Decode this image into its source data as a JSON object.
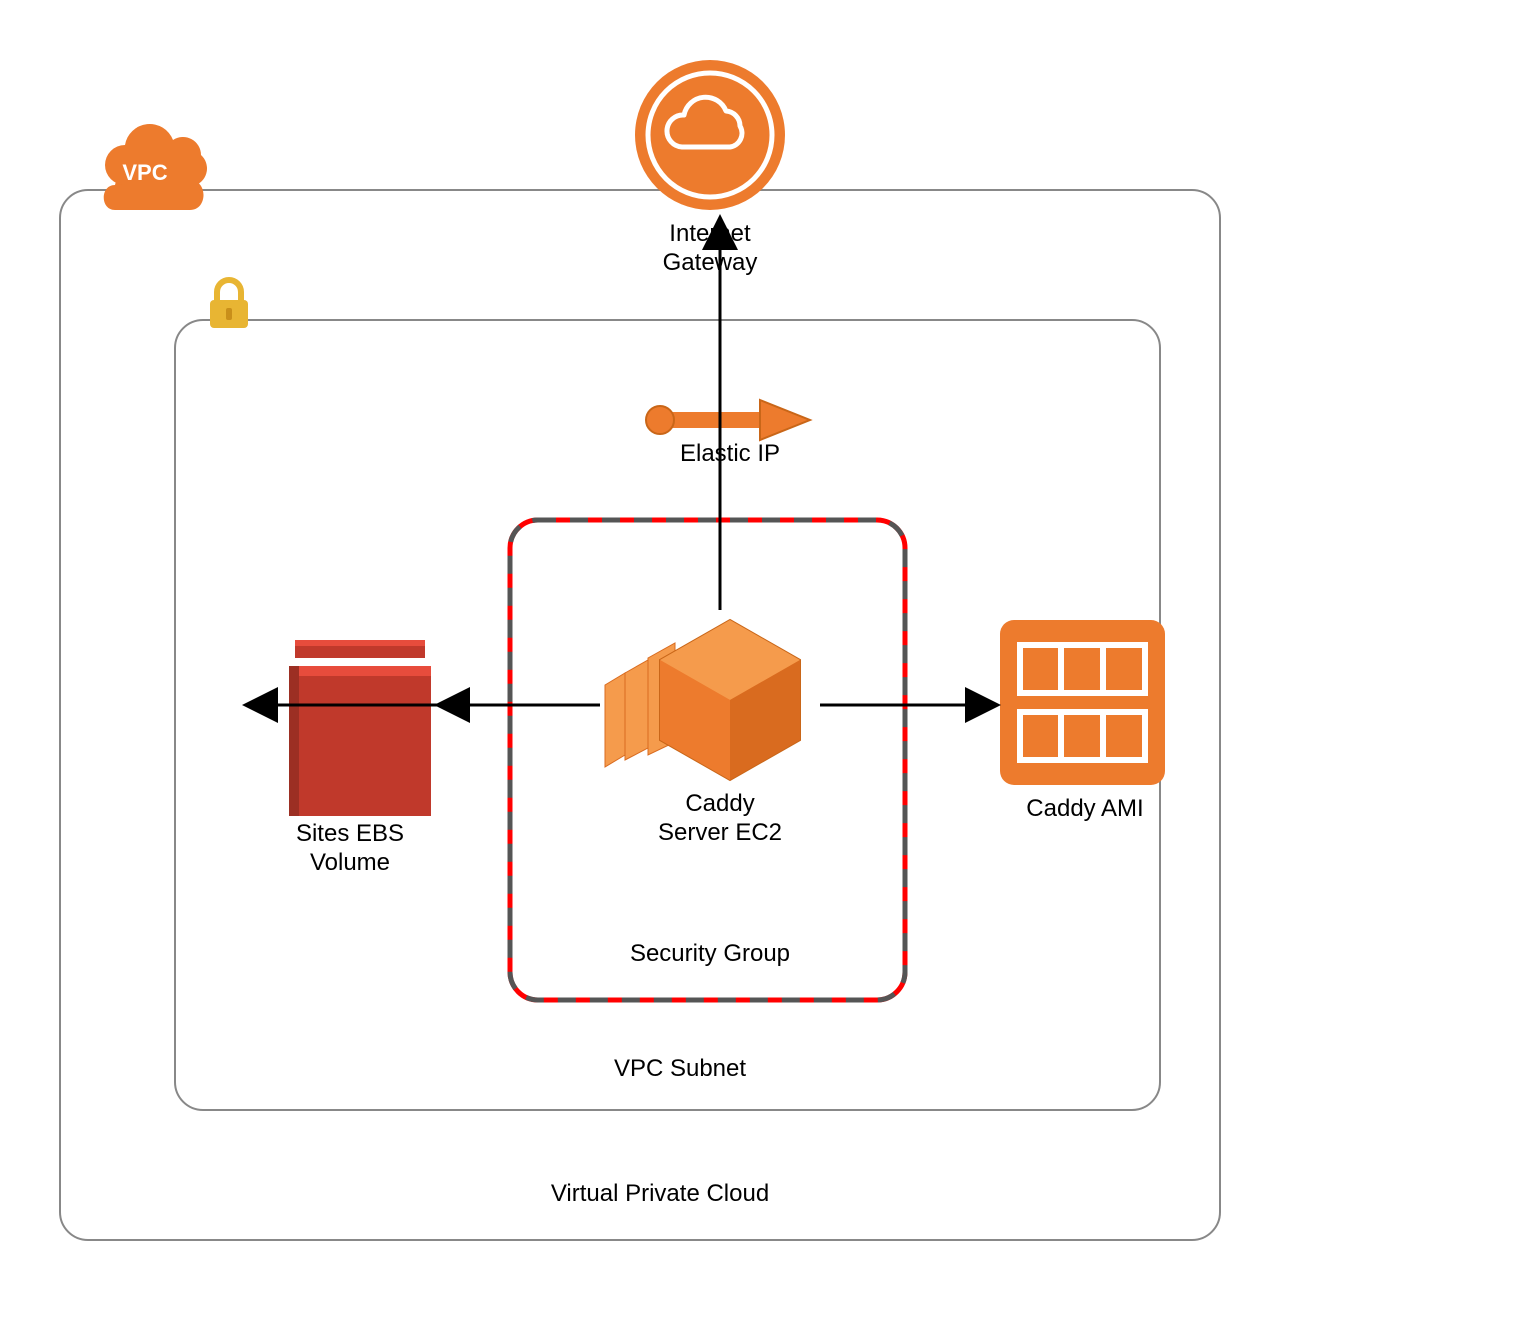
{
  "colors": {
    "aws_orange": "#ED7B2D",
    "aws_orange_dark": "#D96B1F",
    "red": "#C0392B",
    "red_dark": "#9C2F23",
    "gold": "#E8B533",
    "grey": "#888888",
    "ami_light": "#F59B4C"
  },
  "vpc": {
    "badge": "VPC",
    "title": "Virtual Private Cloud"
  },
  "subnet": {
    "title": "VPC Subnet"
  },
  "security_group": {
    "title": "Security Group"
  },
  "internet_gateway": {
    "line1": "Internet",
    "line2": "Gateway"
  },
  "elastic_ip": {
    "label": "Elastic IP"
  },
  "ec2": {
    "line1": "Caddy",
    "line2": "Server EC2"
  },
  "ebs": {
    "line1": "Sites EBS",
    "line2": "Volume"
  },
  "ami": {
    "label": "Caddy AMI"
  }
}
